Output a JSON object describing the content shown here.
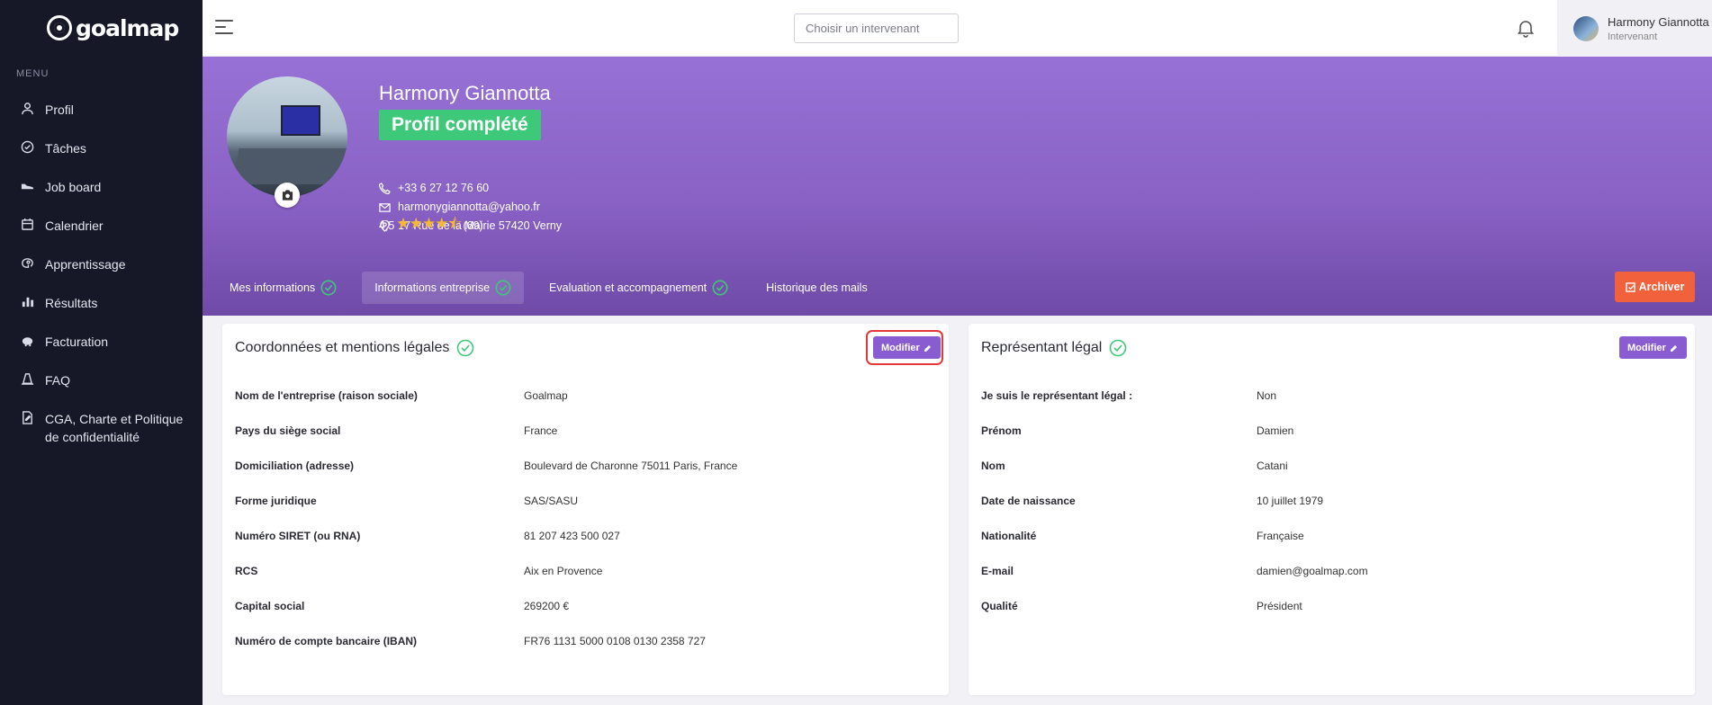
{
  "sidebar": {
    "logo": "goalmap",
    "menu_label": "MENU",
    "items": [
      {
        "label": "Profil",
        "icon": "user-icon"
      },
      {
        "label": "Tâches",
        "icon": "check-circle-icon"
      },
      {
        "label": "Job board",
        "icon": "shoe-icon"
      },
      {
        "label": "Calendrier",
        "icon": "calendar-icon"
      },
      {
        "label": "Apprentissage",
        "icon": "brain-icon"
      },
      {
        "label": "Résultats",
        "icon": "bar-chart-icon"
      },
      {
        "label": "Facturation",
        "icon": "piggy-bank-icon"
      },
      {
        "label": "FAQ",
        "icon": "traffic-cone-icon"
      },
      {
        "label": "CGA, Charte et Politique de confidentialité",
        "icon": "document-edit-icon"
      }
    ]
  },
  "topbar": {
    "search_placeholder": "Choisir un intervenant",
    "user_name": "Harmony Giannotta",
    "user_role": "Intervenant"
  },
  "profile": {
    "name": "Harmony Giannotta",
    "status": "Profil complété",
    "phone": "+33 6 27 12 76 60",
    "email": "harmonygiannotta@yahoo.fr",
    "address": "17 Rue de la Mairie 57420 Verny",
    "rating": "4,5",
    "rating_value": 4.5,
    "rating_count": "(69)"
  },
  "tabs": [
    {
      "label": "Mes informations",
      "complete": true
    },
    {
      "label": "Informations entreprise",
      "complete": true,
      "active": true
    },
    {
      "label": "Evaluation et accompagnement",
      "complete": true
    },
    {
      "label": "Historique des mails",
      "complete": false
    }
  ],
  "archive_label": "Archiver",
  "company_card": {
    "title": "Coordonnées et mentions légales",
    "button": "Modifier",
    "rows": [
      {
        "k": "Nom de l'entreprise (raison sociale)",
        "v": "Goalmap"
      },
      {
        "k": "Pays du siège social",
        "v": "France"
      },
      {
        "k": "Domiciliation (adresse)",
        "v": "Boulevard de Charonne 75011 Paris, France"
      },
      {
        "k": "Forme juridique",
        "v": "SAS/SASU"
      },
      {
        "k": "Numéro SIRET (ou RNA)",
        "v": "81 207 423 500 027"
      },
      {
        "k": "RCS",
        "v": "Aix en Provence"
      },
      {
        "k": "Capital social",
        "v": "269200 €"
      },
      {
        "k": "Numéro de compte bancaire (IBAN)",
        "v": "FR76 1131 5000 0108 0130 2358 727"
      }
    ]
  },
  "legal_card": {
    "title": "Représentant légal",
    "button": "Modifier",
    "rows": [
      {
        "k": "Je suis le représentant légal :",
        "v": "Non"
      },
      {
        "k": "Prénom",
        "v": "Damien"
      },
      {
        "k": "Nom",
        "v": "Catani"
      },
      {
        "k": "Date de naissance",
        "v": "10 juillet 1979"
      },
      {
        "k": "Nationalité",
        "v": "Française"
      },
      {
        "k": "E-mail",
        "v": "damien@goalmap.com"
      },
      {
        "k": "Qualité",
        "v": "Président"
      }
    ]
  },
  "colors": {
    "sidebar": "#161827",
    "accent": "#8a5cd2",
    "success": "#3ec879",
    "danger": "#f0613c"
  }
}
